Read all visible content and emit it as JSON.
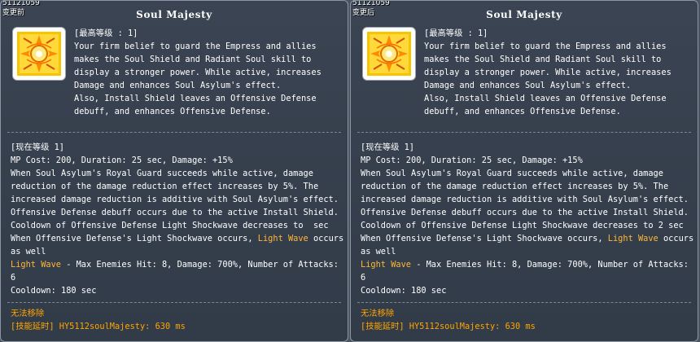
{
  "panels": [
    {
      "skill_id": "51121059",
      "state_tag": "变更前",
      "title": "Soul Majesty",
      "icon": "soul-majesty-icon",
      "desc_lines": [
        "[最高等级 : 1]",
        "Your firm belief to guard the Empress and allies",
        "makes the Soul Shield and Radiant Soul skill to",
        "display a stronger power. While active, increases",
        "Damage and enhances Soul Asylum's effect.",
        "Also, Install Shield leaves an Offensive Defense",
        "debuff, and enhances Offensive Defense."
      ],
      "level_header": "[现在等级 1]",
      "level_lines": [
        "MP Cost: 200, Duration: 25 sec, Damage: +15%",
        "When Soul Asylum's Royal Guard succeeds while active, damage",
        "reduction of the damage reduction effect increases by 5%. The",
        "increased damage reduction is additive with Soul Asylum's effect.",
        "Offensive Defense debuff occurs due to the active Install Shield.",
        "Cooldown of Offensive Defense Light Shockwave decreases to  sec"
      ],
      "lw_prefix": "When Offensive Defense's Light Shockwave occurs, ",
      "lw_highlight": "Light Wave",
      "lw_suffix": " occurs",
      "lw_tail": "as well",
      "lw2_highlight": "Light Wave",
      "lw2_text": " - Max Enemies Hit: 8, Damage: 700%, Number of Attacks:",
      "lw2_tail": "6",
      "cooldown": "Cooldown: 180 sec",
      "footer_line1": "无法移除",
      "footer_line2": "[技能延时] HY5112soulMajesty: 630 ms"
    },
    {
      "skill_id": "51121059",
      "state_tag": "变更后",
      "title": "Soul Majesty",
      "icon": "soul-majesty-icon",
      "desc_lines": [
        "[最高等级 : 1]",
        "Your firm belief to guard the Empress and allies",
        "makes the Soul Shield and Radiant Soul skill to",
        "display a stronger power. While active, increases",
        "Damage and enhances Soul Asylum's effect.",
        "Also, Install Shield leaves an Offensive Defense",
        "debuff, and enhances Offensive Defense."
      ],
      "level_header": "[现在等级 1]",
      "level_lines": [
        "MP Cost: 200, Duration: 25 sec, Damage: +15%",
        "When Soul Asylum's Royal Guard succeeds while active, damage",
        "reduction of the damage reduction effect increases by 5%. The",
        "increased damage reduction is additive with Soul Asylum's effect.",
        "Offensive Defense debuff occurs due to the active Install Shield.",
        "Cooldown of Offensive Defense Light Shockwave decreases to 2 sec"
      ],
      "lw_prefix": "When Offensive Defense's Light Shockwave occurs, ",
      "lw_highlight": "Light Wave",
      "lw_suffix": " occurs",
      "lw_tail": "as well",
      "lw2_highlight": "Light Wave",
      "lw2_text": " - Max Enemies Hit: 8, Damage: 700%, Number of Attacks:",
      "lw2_tail": "6",
      "cooldown": "Cooldown: 180 sec",
      "footer_line1": "无法移除",
      "footer_line2": "[技能延时] HY5112soulMajesty: 630 ms"
    }
  ],
  "colors": {
    "panel_bg": "#343d4a",
    "border": "#8c96a3",
    "highlight": "#ffb63c",
    "footer": "#ffa500",
    "icon_gold": "#f5b800"
  }
}
